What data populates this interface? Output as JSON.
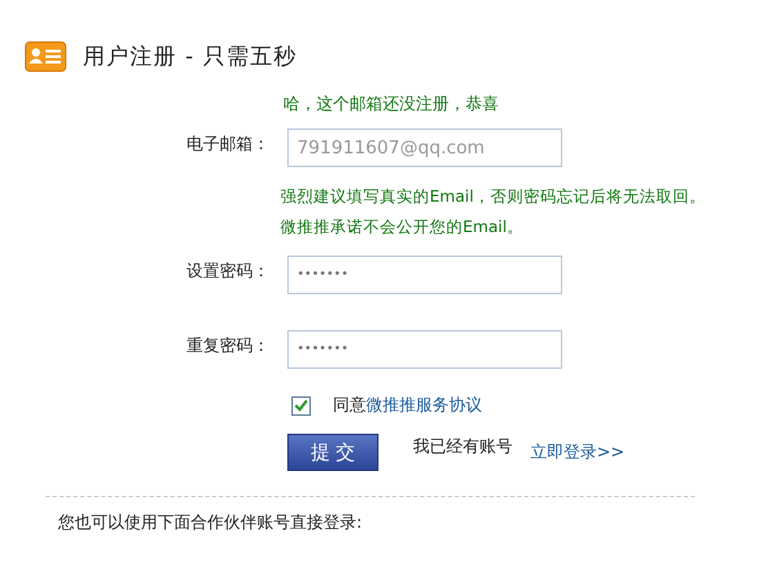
{
  "header": {
    "title": "用户注册 - 只需五秒"
  },
  "status_message": "哈，这个邮箱还没注册，恭喜",
  "fields": [
    {
      "label": "电子邮箱：",
      "value": "791911607@qq.com",
      "hint": [
        "强烈建议填写真实的Email，否则密码忘记后将无法取回。",
        "微推推承诺不会公开您的Email。"
      ]
    },
    {
      "label": "设置密码：",
      "value": "•••••••"
    },
    {
      "label": "重复密码：",
      "value": "•••••••"
    }
  ],
  "agreement": {
    "checked": true,
    "label": "同意",
    "link": "微推推服务协议"
  },
  "submit_button": "提 交",
  "login_prompt": {
    "text": "我已经有账号",
    "link": "立即登录>>"
  },
  "partner_login_text": "您也可以使用下面合作伙伴账号直接登录:"
}
